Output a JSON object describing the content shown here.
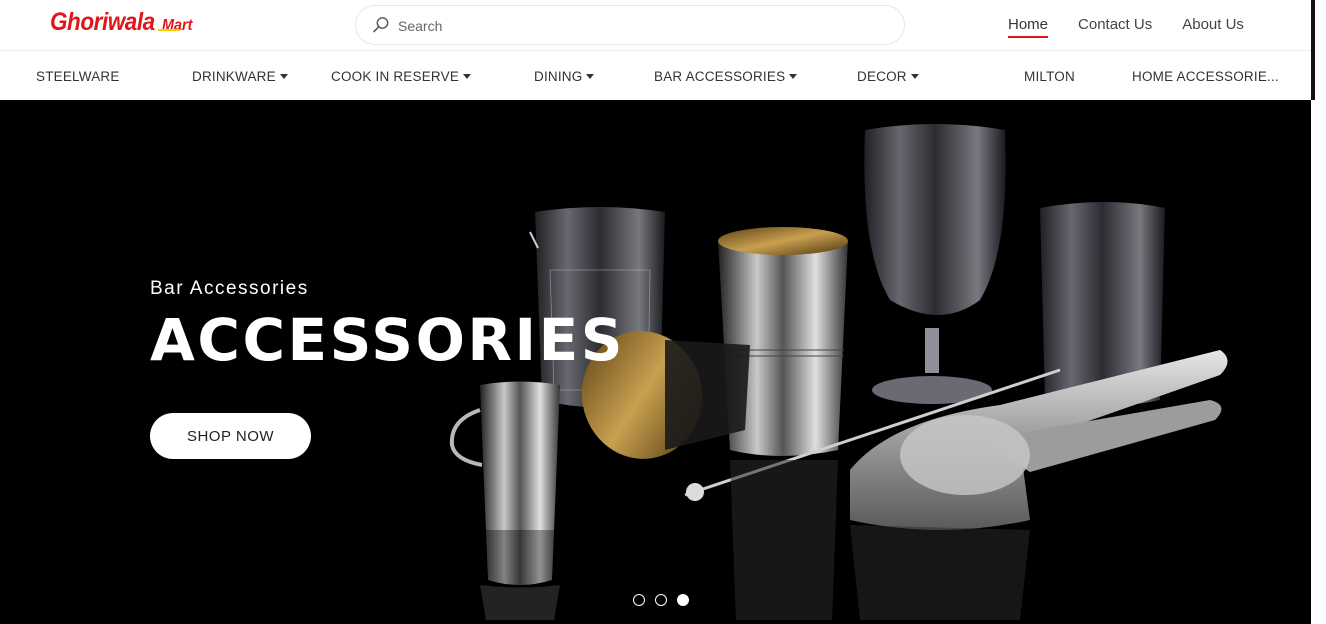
{
  "header": {
    "logo_main": "Ghoriwala",
    "logo_sub": "Mart",
    "search": {
      "placeholder": "Search",
      "value": ""
    },
    "links": [
      {
        "label": "Home",
        "active": true
      },
      {
        "label": "Contact Us",
        "active": false
      },
      {
        "label": "About Us",
        "active": false
      }
    ]
  },
  "categories": [
    {
      "label": "STEELWARE",
      "has_dropdown": false
    },
    {
      "label": "DRINKWARE",
      "has_dropdown": true
    },
    {
      "label": "COOK IN RESERVE",
      "has_dropdown": true
    },
    {
      "label": "DINING",
      "has_dropdown": true
    },
    {
      "label": "BAR ACCESSORIES",
      "has_dropdown": true
    },
    {
      "label": "DECOR",
      "has_dropdown": true
    },
    {
      "label": "MILTON",
      "has_dropdown": false
    },
    {
      "label": "HOME ACCESSORIE...",
      "has_dropdown": false
    }
  ],
  "hero": {
    "subtitle": "Bar Accessories",
    "title": "ACCESSORIES",
    "cta_label": "SHOP NOW",
    "slides_total": 3,
    "active_slide": 3
  },
  "colors": {
    "brand_red": "#e0161b",
    "logo_accent": "#f2d200",
    "hero_bg": "#000000"
  }
}
